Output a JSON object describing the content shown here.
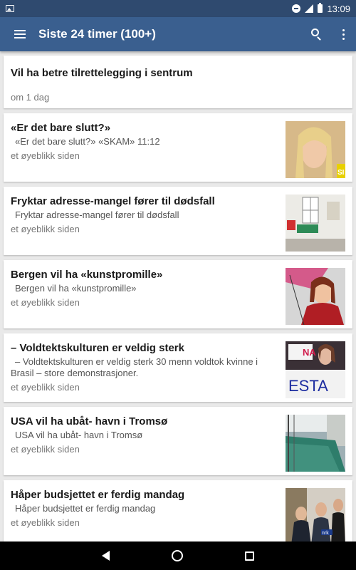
{
  "status_bar": {
    "time": "13:09"
  },
  "app_bar": {
    "title": "Siste 24 timer (100+)"
  },
  "cards": [
    {
      "title": "Vil ha betre tilrettelegging i sentrum",
      "summary": "",
      "time": "om 1 dag"
    },
    {
      "title": "«Er det bare slutt?»",
      "summary": "«Er det bare slutt?»  «SKAM» 11:12",
      "time": "et øyeblikk siden"
    },
    {
      "title": "Fryktar adresse-mangel fører til dødsfall",
      "summary": "Fryktar adresse-mangel fører til dødsfall",
      "time": "et øyeblikk siden"
    },
    {
      "title": "Bergen vil ha «kunstpromille»",
      "summary": "Bergen vil ha «kunstpromille»",
      "time": "et øyeblikk siden"
    },
    {
      "title": "– Voldtektskulturen er veldig sterk",
      "summary": "– Voldtektskulturen er veldig sterk 30 menn voldtok kvinne i Brasil – store demonstrasjoner.",
      "time": "et øyeblikk siden"
    },
    {
      "title": "USA vil ha ubåt- havn i Tromsø",
      "summary": "USA vil ha ubåt- havn i Tromsø",
      "time": "et øyeblikk siden"
    },
    {
      "title": "Håper budsjettet er ferdig mandag",
      "summary": "Håper budsjettet er ferdig mandag",
      "time": "et øyeblikk siden"
    }
  ],
  "thumb_texts": {
    "skam": "SI",
    "protest_top": "NA",
    "protest_bottom": "ESTA",
    "nrk": "nrk"
  },
  "colors": {
    "status_bar": "#2f4a6f",
    "app_bar": "#3a5f8f",
    "background": "#e9e9e9",
    "nav_bar": "#000000"
  }
}
